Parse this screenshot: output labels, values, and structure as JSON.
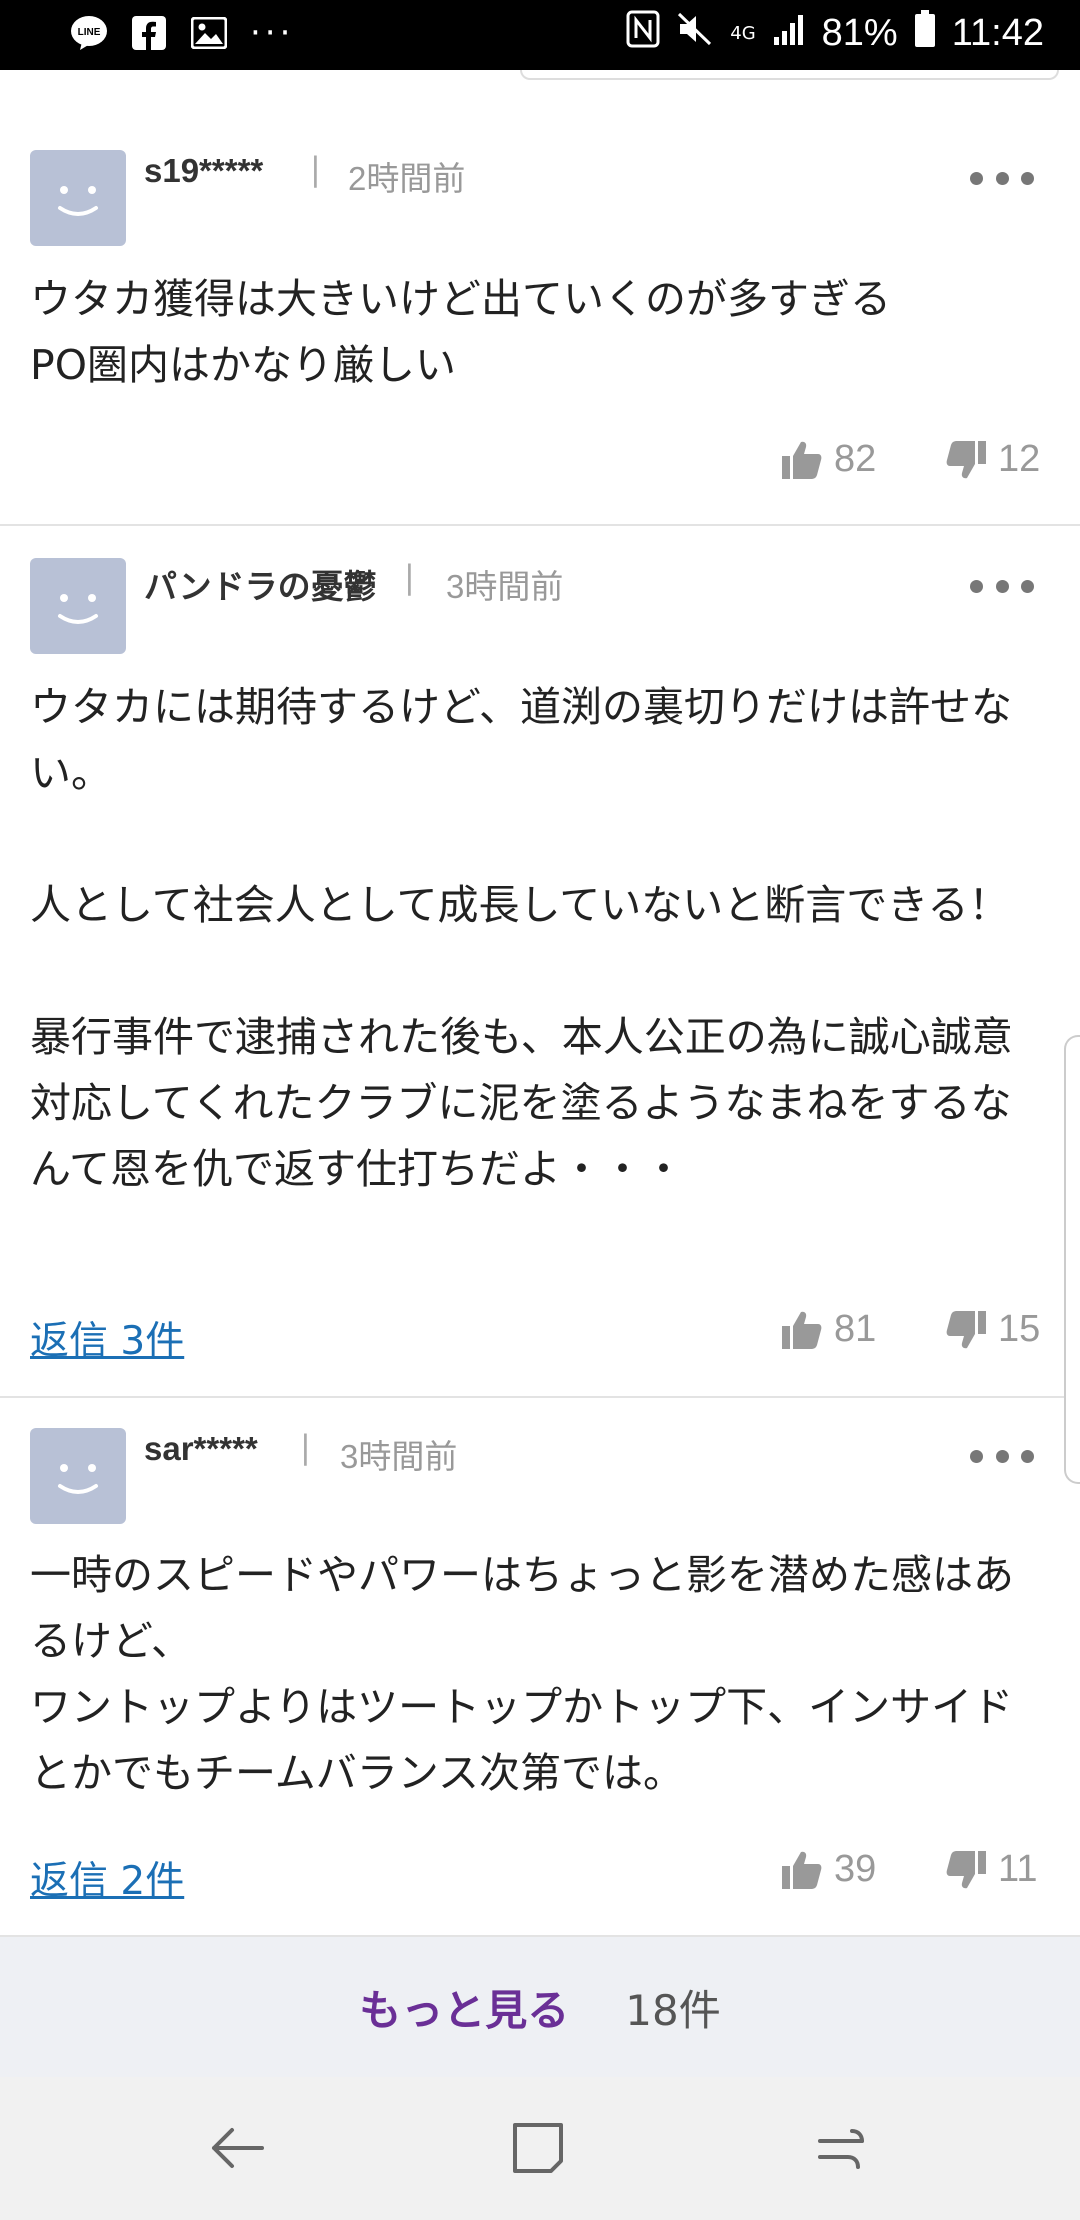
{
  "status_bar": {
    "left_icons": [
      "line-icon",
      "facebook-icon",
      "gallery-icon"
    ],
    "more": "···",
    "battery": "81%",
    "time": "11:42",
    "network": "4G"
  },
  "comments": [
    {
      "user": "s19*****",
      "time": "2時間前",
      "text": "ウタカ獲得は大きいけど出ていくのが多すぎる\nPO圏内はかなり厳しい",
      "likes": "82",
      "dislikes": "12",
      "replies": ""
    },
    {
      "user": "パンドラの憂鬱",
      "time": "3時間前",
      "text": "ウタカには期待するけど、道渕の裏切りだけは許せない。\n\n人として社会人として成長していないと断言できる！\n\n暴行事件で逮捕された後も、本人公正の為に誠心誠意対応してくれたクラブに泥を塗るようなまねをするなんて恩を仇で返す仕打ちだよ・・・",
      "likes": "81",
      "dislikes": "15",
      "replies": "返信 3件"
    },
    {
      "user": "sar*****",
      "time": "3時間前",
      "text": "一時のスピードやパワーはちょっと影を潜めた感はあるけど、\nワントップよりはツートップかトップ下、インサイドとかでもチームバランス次第では。",
      "likes": "39",
      "dislikes": "11",
      "replies": "返信 2件"
    }
  ],
  "more": {
    "label": "もっと見る",
    "count": "18件"
  }
}
